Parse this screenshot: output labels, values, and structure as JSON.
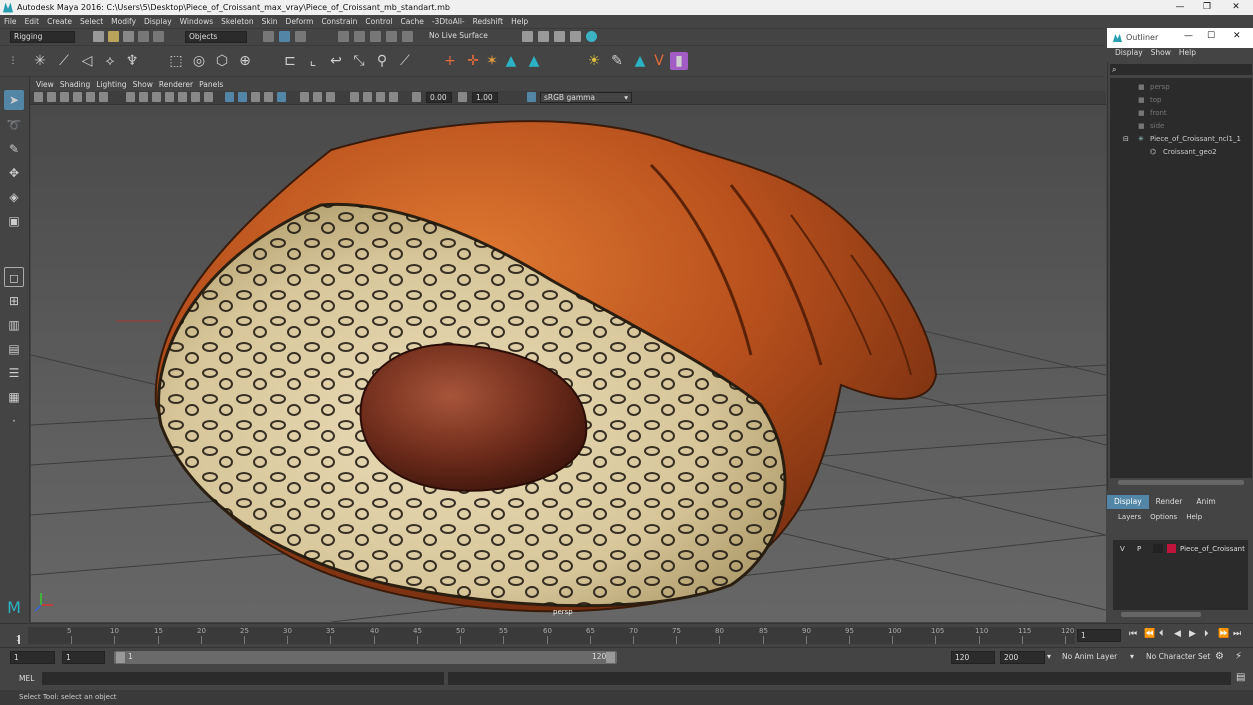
{
  "window": {
    "title": "Autodesk Maya 2016: C:\\Users\\5\\Desktop\\Piece_of_Croissant_max_vray\\Piece_of_Croissant_mb_standart.mb"
  },
  "menu": [
    "File",
    "Edit",
    "Create",
    "Select",
    "Modify",
    "Display",
    "Windows",
    "Skeleton",
    "Skin",
    "Deform",
    "Constrain",
    "Control",
    "Cache",
    "-3DtoAll-",
    "Redshift",
    "Help"
  ],
  "shelf": {
    "mode": "Rigging",
    "objects": "Objects",
    "live_surface": "No Live Surface"
  },
  "viewport": {
    "menu": [
      "View",
      "Shading",
      "Lighting",
      "Show",
      "Renderer",
      "Panels"
    ],
    "exposure": "0.00",
    "gamma": "1.00",
    "color_space": "sRGB gamma",
    "camera_label": "persp"
  },
  "outliner": {
    "title": "Outliner",
    "menu": [
      "Display",
      "Show",
      "Help"
    ],
    "items": [
      "persp",
      "top",
      "front",
      "side",
      "Piece_of_Croissant_ncl1_1",
      "Croissant_geo2"
    ]
  },
  "layers": {
    "tabs": [
      "Display",
      "Render",
      "Anim"
    ],
    "menu": [
      "Layers",
      "Options",
      "Help"
    ],
    "row": {
      "v": "V",
      "p": "P",
      "name": "Piece_of_Croissant",
      "color": "#c0143c"
    }
  },
  "timeline": {
    "ticks": [
      "5",
      "10",
      "15",
      "20",
      "25",
      "30",
      "35",
      "40",
      "45",
      "50",
      "55",
      "60",
      "65",
      "70",
      "75",
      "80",
      "85",
      "90",
      "95",
      "100",
      "105",
      "110",
      "115",
      "120"
    ],
    "current_start": "1",
    "current_frame": "1"
  },
  "range": {
    "start": "1",
    "start2": "1",
    "slider_start": "1",
    "slider_end": "120",
    "end": "120",
    "end2": "200",
    "anim_layer": "No Anim Layer",
    "char_set": "No Character Set"
  },
  "mel": {
    "label": "MEL"
  },
  "status": {
    "text": "Select Tool: select an object"
  }
}
